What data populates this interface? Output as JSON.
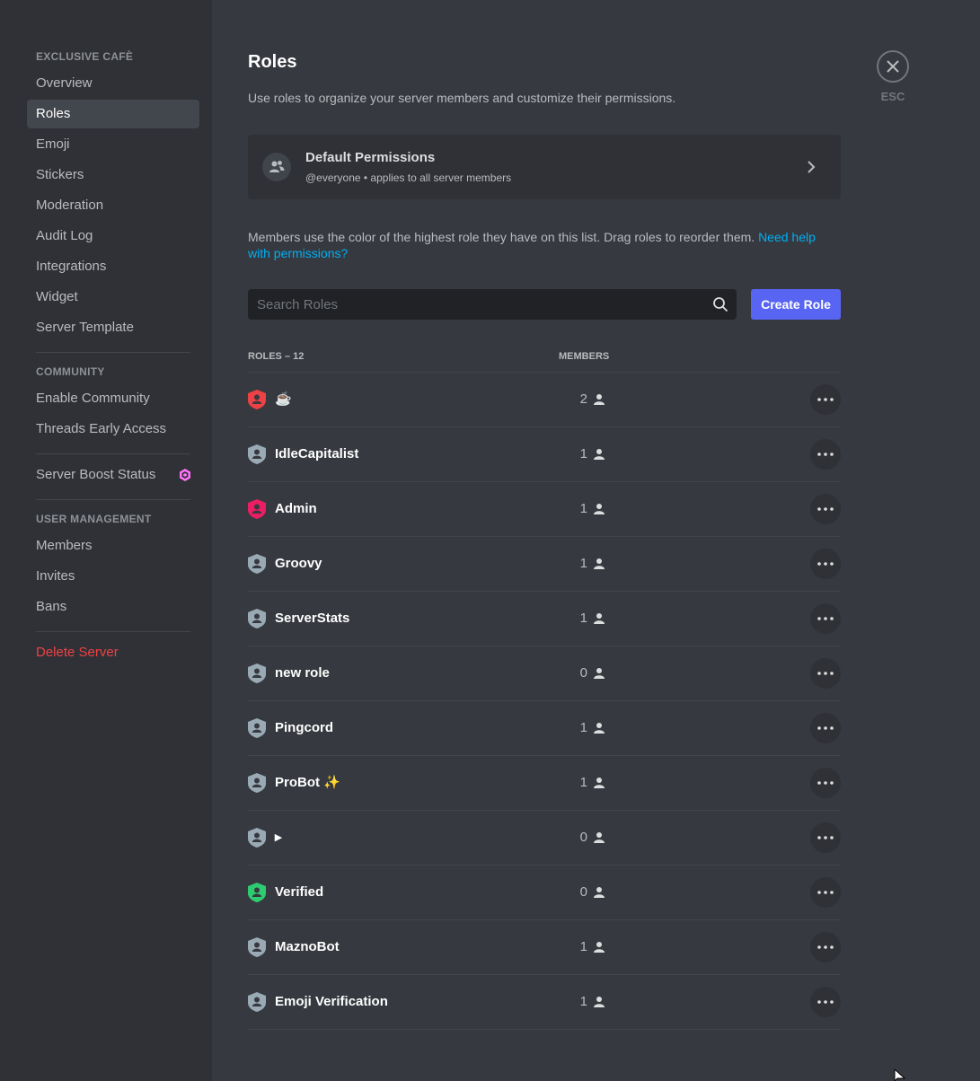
{
  "sidebar": {
    "server_header": "EXCLUSIVE CAFÈ",
    "server_items": [
      {
        "label": "Overview"
      },
      {
        "label": "Roles"
      },
      {
        "label": "Emoji"
      },
      {
        "label": "Stickers"
      },
      {
        "label": "Moderation"
      },
      {
        "label": "Audit Log"
      },
      {
        "label": "Integrations"
      },
      {
        "label": "Widget"
      },
      {
        "label": "Server Template"
      }
    ],
    "active_item": "Roles",
    "community_header": "COMMUNITY",
    "community_items": [
      {
        "label": "Enable Community"
      },
      {
        "label": "Threads Early Access"
      }
    ],
    "boost_label": "Server Boost Status",
    "user_mgmt_header": "USER MANAGEMENT",
    "user_mgmt_items": [
      {
        "label": "Members"
      },
      {
        "label": "Invites"
      },
      {
        "label": "Bans"
      }
    ],
    "delete_label": "Delete Server"
  },
  "main": {
    "title": "Roles",
    "subtitle": "Use roles to organize your server members and customize their permissions.",
    "default_permissions": {
      "title": "Default Permissions",
      "subtitle": "@everyone • applies to all server members"
    },
    "info_text": "Members use the color of the highest role they have on this list. Drag roles to reorder them. ",
    "info_link": "Need help with permissions?",
    "search_placeholder": "Search Roles",
    "create_role_label": "Create Role",
    "col_roles": "ROLES – 12",
    "col_members": "MEMBERS"
  },
  "roles": [
    {
      "name": "☕",
      "members": "2",
      "color": "#ed4245"
    },
    {
      "name": "IdleCapitalist",
      "members": "1",
      "color": "#99aab5"
    },
    {
      "name": "Admin",
      "members": "1",
      "color": "#e91e63"
    },
    {
      "name": "Groovy",
      "members": "1",
      "color": "#99aab5"
    },
    {
      "name": "ServerStats",
      "members": "1",
      "color": "#99aab5"
    },
    {
      "name": "new role",
      "members": "0",
      "color": "#99aab5"
    },
    {
      "name": "Pingcord",
      "members": "1",
      "color": "#99aab5"
    },
    {
      "name": "ProBot ✨",
      "members": "1",
      "color": "#99aab5"
    },
    {
      "name": "▸",
      "members": "0",
      "color": "#99aab5"
    },
    {
      "name": "Verified",
      "members": "0",
      "color": "#2ecc71"
    },
    {
      "name": "MaznoBot",
      "members": "1",
      "color": "#99aab5"
    },
    {
      "name": "Emoji Verification",
      "members": "1",
      "color": "#99aab5"
    }
  ],
  "close": {
    "esc_label": "ESC"
  },
  "colors": {
    "accent": "#5865f2",
    "link": "#00aff4",
    "danger": "#ed4245",
    "boost": "#ff73fa"
  }
}
